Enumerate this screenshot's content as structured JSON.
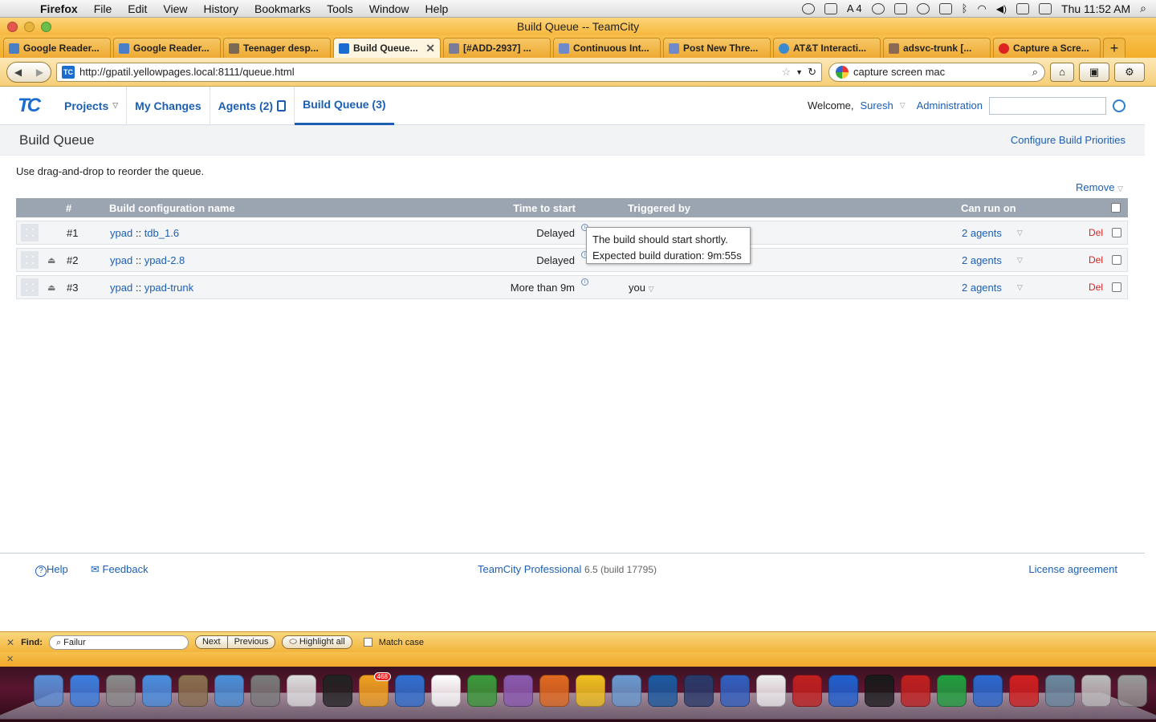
{
  "menubar": {
    "app": "Firefox",
    "items": [
      "File",
      "Edit",
      "View",
      "History",
      "Bookmarks",
      "Tools",
      "Window",
      "Help"
    ],
    "clock": "Thu 11:52 AM",
    "adobe_count": "4"
  },
  "window_title": "Build Queue -- TeamCity",
  "tabs": [
    {
      "label": "Google Reader...",
      "color": "#4a7ec7"
    },
    {
      "label": "Google Reader...",
      "color": "#4a7ec7"
    },
    {
      "label": "Teenager desp...",
      "color": "#7a6a55"
    },
    {
      "label": "Build Queue...",
      "color": "#1b6ccf",
      "active": true
    },
    {
      "label": "[#ADD-2937] ...",
      "color": "#7a7a9a"
    },
    {
      "label": "Continuous Int...",
      "color": "#6f89c9"
    },
    {
      "label": "Post New Thre...",
      "color": "#6f89c9"
    },
    {
      "label": "AT&T Interacti...",
      "color": "#3a8ad0"
    },
    {
      "label": "adsvc-trunk [...",
      "color": "#8a6a55"
    },
    {
      "label": "Capture a Scre...",
      "color": "#d22"
    }
  ],
  "nav": {
    "url": "http://gpatil.yellowpages.local:8111/queue.html",
    "search": "capture screen mac"
  },
  "tc": {
    "logo": "TC",
    "nav": {
      "projects": "Projects",
      "changes": "My Changes",
      "agents": "Agents (2)",
      "queue": "Build Queue (3)"
    },
    "welcome": "Welcome,",
    "user": "Suresh",
    "admin": "Administration"
  },
  "page": {
    "title": "Build Queue",
    "configure": "Configure Build Priorities",
    "hint": "Use drag-and-drop to reorder the queue.",
    "remove": "Remove"
  },
  "queue": {
    "headers": {
      "num": "#",
      "name": "Build configuration name",
      "time": "Time to start",
      "trig": "Triggered by",
      "can": "Can run on"
    },
    "rows": [
      {
        "num": "#1",
        "project": "ypad",
        "sep": "::",
        "config": "tdb_1.6",
        "time": "Delayed",
        "trig": "",
        "can": "2 agents",
        "del": "Del"
      },
      {
        "num": "#2",
        "project": "ypad",
        "sep": "::",
        "config": "ypad-2.8",
        "time": "Delayed",
        "trig": "",
        "can": "2 agents",
        "del": "Del"
      },
      {
        "num": "#3",
        "project": "ypad",
        "sep": "::",
        "config": "ypad-trunk",
        "time": "More than 9m",
        "trig": "you",
        "can": "2 agents",
        "del": "Del"
      }
    ]
  },
  "tooltip": {
    "line1": "The build should start shortly.",
    "line2": "Expected build duration: 9m:55s"
  },
  "footer": {
    "help": "Help",
    "feedback": "Feedback",
    "product": "TeamCity Professional",
    "version": "6.5 (build 17795)",
    "license": "License agreement"
  },
  "findbar": {
    "label": "Find:",
    "value": "Failur",
    "next": "Next",
    "previous": "Previous",
    "highlight": "Highlight all",
    "match": "Match case"
  },
  "dock": {
    "badge": "468",
    "colors": [
      "#5a8ed6",
      "#3c7fe0",
      "#8a8a8a",
      "#4a8fe0",
      "#8a7050",
      "#4a90d8",
      "#7a7a7a",
      "#dddddd",
      "#222222",
      "#f0a020",
      "#2f70d0",
      "#ffffff",
      "#3a9a3a",
      "#8a5ab0",
      "#e06a20",
      "#f0c020",
      "#6a9ad0",
      "#1a5aa0",
      "#2a3a6a",
      "#3060c0",
      "#eeeeee",
      "#c02020",
      "#2060d0",
      "#1a1a1a",
      "#c02020",
      "#20a040",
      "#2a6ad0",
      "#d02020",
      "#6a8aa0",
      "#bbbbbb",
      "#999999"
    ]
  }
}
